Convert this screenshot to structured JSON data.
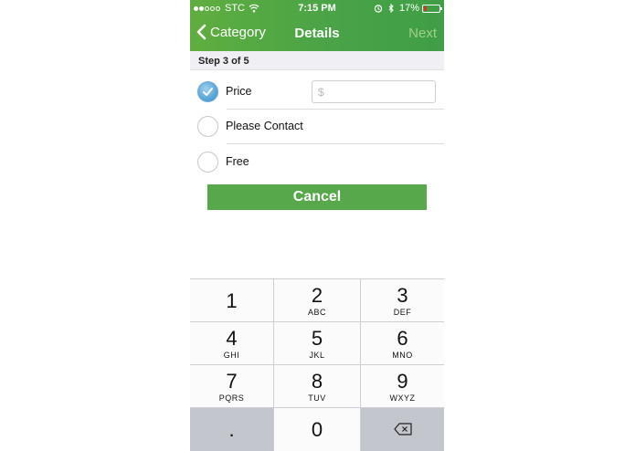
{
  "status_bar": {
    "carrier": "STC",
    "time": "7:15 PM",
    "battery_percent": "17%",
    "signal_bars_full": 2,
    "signal_bars_total": 5
  },
  "nav": {
    "back_label": "Category",
    "title": "Details",
    "next_label": "Next"
  },
  "step": {
    "label": "Step 3 of 5"
  },
  "options": [
    {
      "label": "Price",
      "checked": true
    },
    {
      "label": "Please Contact",
      "checked": false
    },
    {
      "label": "Free",
      "checked": false
    }
  ],
  "price_input": {
    "placeholder": "$",
    "value": ""
  },
  "cancel_label": "Cancel",
  "keypad": {
    "keys": [
      {
        "digit": "1",
        "letters": ""
      },
      {
        "digit": "2",
        "letters": "ABC"
      },
      {
        "digit": "3",
        "letters": "DEF"
      },
      {
        "digit": "4",
        "letters": "GHI"
      },
      {
        "digit": "5",
        "letters": "JKL"
      },
      {
        "digit": "6",
        "letters": "MNO"
      },
      {
        "digit": "7",
        "letters": "PQRS"
      },
      {
        "digit": "8",
        "letters": "TUV"
      },
      {
        "digit": "9",
        "letters": "WXYZ"
      }
    ],
    "decimal": ".",
    "zero": "0",
    "delete_icon": "backspace-icon"
  },
  "colors": {
    "header_green": "#4aa347",
    "cancel_green": "#56a84b",
    "radio_blue": "#5aa6d8",
    "battery_low": "#e0302a"
  }
}
